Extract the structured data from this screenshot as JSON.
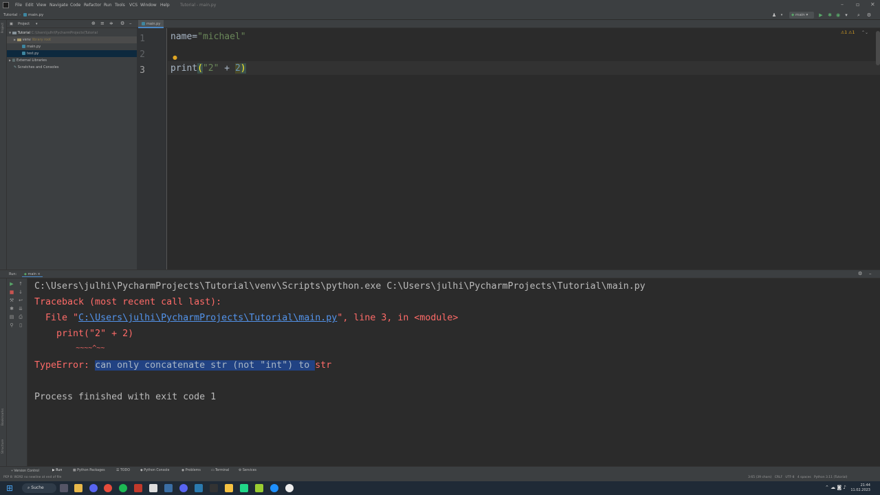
{
  "menubar": {
    "items": [
      "File",
      "Edit",
      "View",
      "Navigate",
      "Code",
      "Refactor",
      "Run",
      "Tools",
      "VCS",
      "Window",
      "Help"
    ],
    "window_title": "Tutorial - main.py"
  },
  "navbar": {
    "project_crumb": "Tutorial",
    "file_crumb": "main.py",
    "run_config": "main"
  },
  "left_strip": {
    "top_label": "Project",
    "bottom_labels": [
      "Bookmarks",
      "Structure"
    ]
  },
  "project_panel": {
    "header": "Project",
    "tree": [
      {
        "label": "Tutorial",
        "hint": "C:\\Users\\julhi\\PycharmProjects\\Tutorial",
        "type": "folder"
      },
      {
        "label": "venv",
        "hint": "library root",
        "type": "folder"
      },
      {
        "label": "main.py",
        "type": "py"
      },
      {
        "label": "test.py",
        "type": "py"
      },
      {
        "label": "External Libraries",
        "type": "lib"
      },
      {
        "label": "Scratches and Consoles",
        "type": "scratch"
      }
    ]
  },
  "editor": {
    "tab": "main.py",
    "line_numbers": [
      "1",
      "2",
      "3"
    ],
    "lines": {
      "l1_var": "name=",
      "l1_str": "\"michael\"",
      "l3_fn": "print",
      "l3_open": "(",
      "l3_str": "\"2\"",
      "l3_op": " + ",
      "l3_num": "2",
      "l3_close": ")"
    },
    "warnings": "⚠1 ⚠1"
  },
  "run_panel": {
    "label": "Run:",
    "tab": "main"
  },
  "console": {
    "cmd": "C:\\Users\\julhi\\PycharmProjects\\Tutorial\\venv\\Scripts\\python.exe C:\\Users\\julhi\\PycharmProjects\\Tutorial\\main.py",
    "traceback": "Traceback (most recent call last):",
    "file_prefix": "  File \"",
    "file_link": "C:\\Users\\julhi\\PycharmProjects\\Tutorial\\main.py",
    "file_suffix": "\", line 3, in <module>",
    "code_line": "    print(\"2\" + 2)",
    "caret_line": "          ~~~~^~~",
    "error_prefix": "TypeError: ",
    "error_selected": "can only concatenate str (not \"int\") to ",
    "error_rest": "str",
    "exit": "Process finished with exit code 1"
  },
  "tool_windows": [
    "Version Control",
    "Run",
    "Python Packages",
    "TODO",
    "Python Console",
    "Problems",
    "Terminal",
    "Services"
  ],
  "statusbar": {
    "message": "PEP 8: W292 no newline at end of file",
    "right": "3:65 (39 chars)   CRLF   UTF-8   4 spaces   Python 3.11 (Tutorial)"
  },
  "taskbar": {
    "search": "Suche",
    "time": "21:44",
    "date": "11.02.2023"
  }
}
